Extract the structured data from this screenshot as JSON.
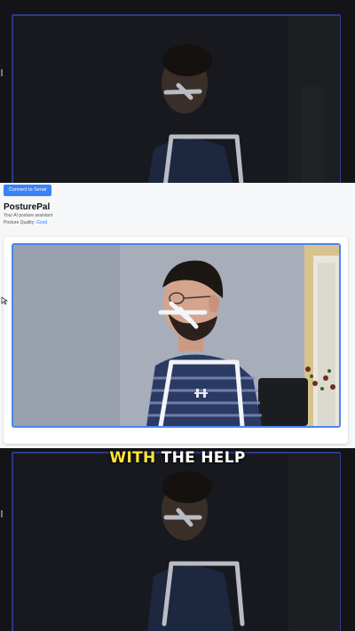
{
  "app": {
    "connect_button": "Connect to Serial",
    "title": "PosturePal",
    "subtitle": "Your AI posture assistant",
    "quality_label": "Posture Quality: ",
    "quality_value": "Good"
  },
  "caption": {
    "highlight": "WITH",
    "rest": "THE HELP"
  },
  "colors": {
    "accent": "#3b82f6",
    "frame": "#4a86f0",
    "caption_highlight": "#ffe335"
  },
  "icons": {
    "cursor": "mouse-cursor-icon",
    "pose_overlay": "pose-skeleton-overlay"
  }
}
